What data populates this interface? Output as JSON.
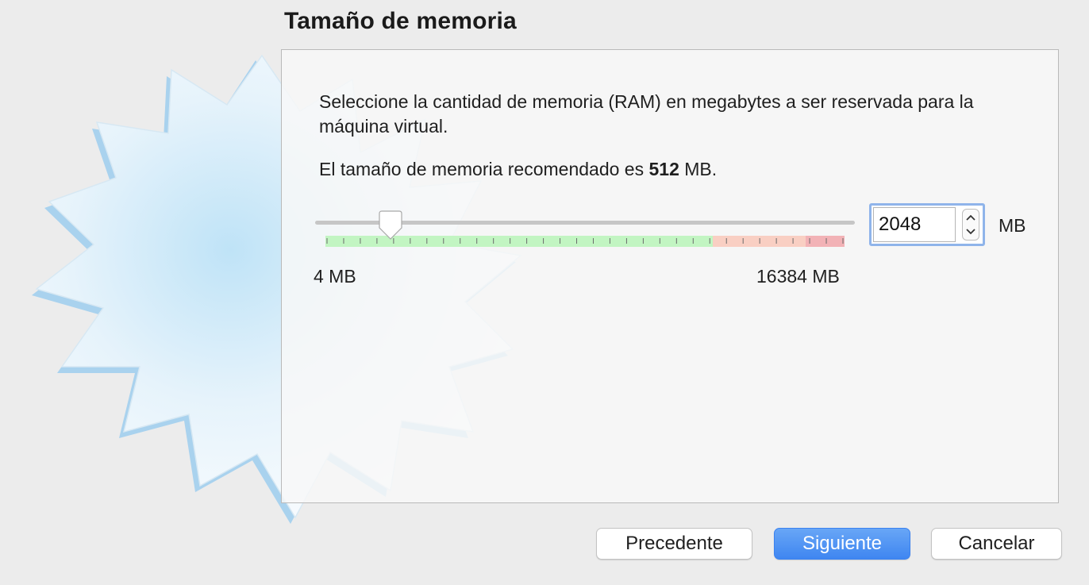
{
  "page": {
    "title": "Tamaño de memoria"
  },
  "memory": {
    "description": "Seleccione la cantidad de memoria (RAM) en megabytes a ser reservada para la máquina virtual.",
    "recommended_prefix": "El tamaño de memoria recomendado es",
    "recommended_value": "512",
    "recommended_suffix": "MB.",
    "slider": {
      "min_label": "4 MB",
      "max_label": "16384 MB",
      "min_value": 4,
      "max_value": 16384,
      "value": 2048,
      "zone_colors": {
        "ok": "#c2f5c2",
        "warn": "#f9cfc3",
        "danger": "#f2b2b6"
      }
    },
    "input_value": "2048",
    "unit_label": "MB"
  },
  "buttons": {
    "back_label": "Precedente",
    "next_label": "Siguiente",
    "cancel_label": "Cancelar"
  },
  "icons": {
    "wizard_art": "starburst-wizard-icon",
    "spinner_up": "chevron-up-icon",
    "spinner_down": "chevron-down-icon"
  },
  "colors": {
    "accent": "#3f86f1",
    "focus_ring": "#8fb4ea"
  }
}
